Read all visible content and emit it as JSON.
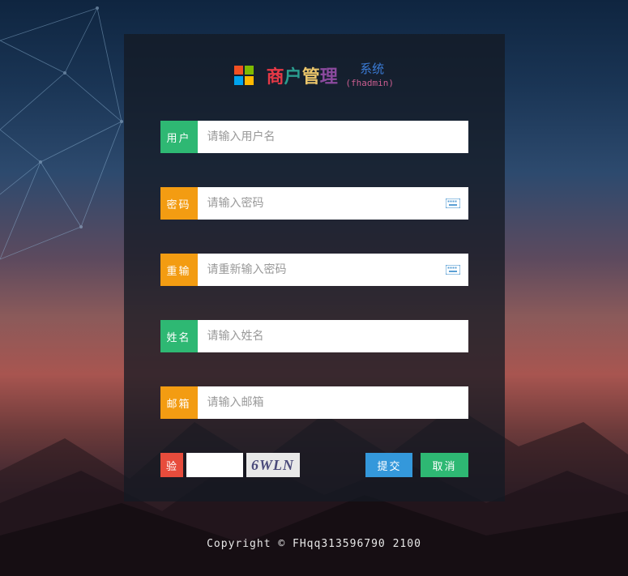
{
  "logo": {
    "char1": "商",
    "char2": "户",
    "char3": "管",
    "char4": "理",
    "system": "系统",
    "sub": "(fhadmin)"
  },
  "fields": {
    "username": {
      "label": "用户",
      "placeholder": "请输入用户名"
    },
    "password": {
      "label": "密码",
      "placeholder": "请输入密码"
    },
    "repassword": {
      "label": "重输",
      "placeholder": "请重新输入密码"
    },
    "realname": {
      "label": "姓名",
      "placeholder": "请输入姓名"
    },
    "email": {
      "label": "邮箱",
      "placeholder": "请输入邮箱"
    }
  },
  "captcha": {
    "label": "验",
    "code": "6WLN"
  },
  "buttons": {
    "submit": "提交",
    "cancel": "取消"
  },
  "footer": "Copyright © FHqq313596790 2100"
}
